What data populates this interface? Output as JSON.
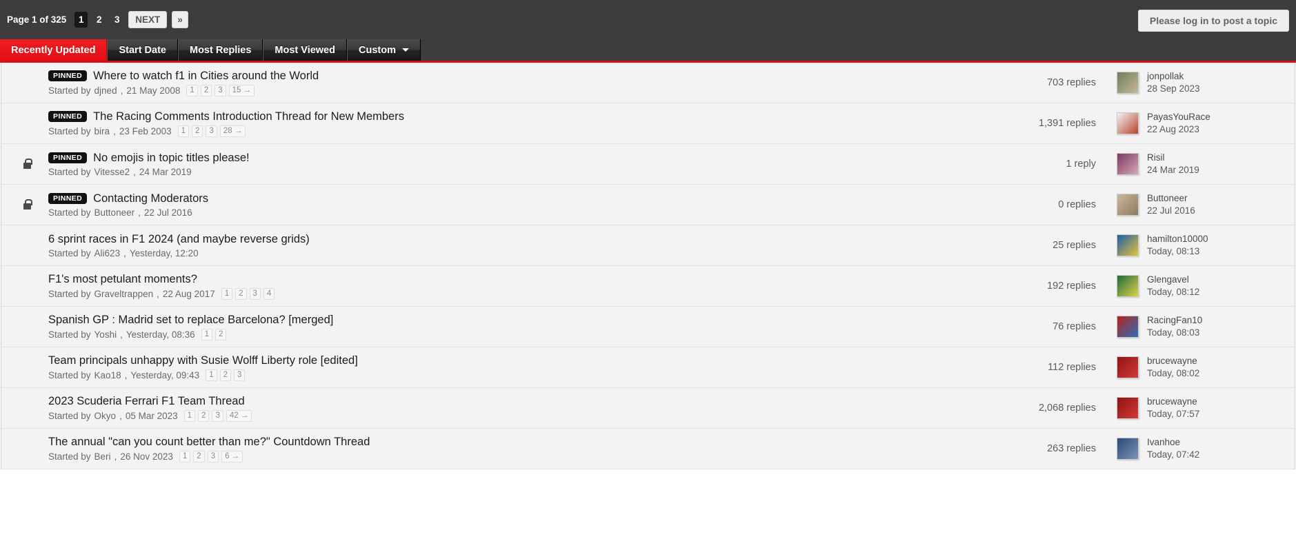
{
  "header": {
    "page_label": "Page 1 of 325",
    "pages": [
      "1",
      "2",
      "3"
    ],
    "next_label": "NEXT",
    "last_label": "»",
    "login_button": "Please log in to post a topic"
  },
  "tabs": [
    {
      "label": "Recently Updated",
      "active": true,
      "caret": false
    },
    {
      "label": "Start Date",
      "active": false,
      "caret": false
    },
    {
      "label": "Most Replies",
      "active": false,
      "caret": false
    },
    {
      "label": "Most Viewed",
      "active": false,
      "caret": false
    },
    {
      "label": "Custom",
      "active": false,
      "caret": true
    }
  ],
  "labels": {
    "started_by": "Started by",
    "comma": ","
  },
  "colors": {
    "accent_red": "#e8131a",
    "topbar": "#3b3b3b",
    "row_bg": "#f3f3f3",
    "pinned_badge": "#111111"
  },
  "topics": [
    {
      "locked": false,
      "pinned": true,
      "pinned_label": "PINNED",
      "title": "Where to watch f1 in Cities around the World",
      "author": "djned",
      "date": "21 May 2008",
      "pages": [
        "1",
        "2",
        "3",
        "15 →"
      ],
      "replies": "703 replies",
      "last_user": "jonpollak",
      "last_date": "28 Sep 2023",
      "avatar_color": "#6d7f5a",
      "avatar_color2": "#c9b79a"
    },
    {
      "locked": false,
      "pinned": true,
      "pinned_label": "PINNED",
      "title": "The Racing Comments Introduction Thread for New Members",
      "author": "bira",
      "date": "23 Feb 2003",
      "pages": [
        "1",
        "2",
        "3",
        "28 →"
      ],
      "replies": "1,391 replies",
      "last_user": "PayasYouRace",
      "last_date": "22 Aug 2023",
      "avatar_color": "#f2f2f2",
      "avatar_color2": "#b8442e"
    },
    {
      "locked": true,
      "pinned": true,
      "pinned_label": "PINNED",
      "title": "No emojis in topic titles please!",
      "author": "Vitesse2",
      "date": "24 Mar 2019",
      "pages": [],
      "replies": "1 reply",
      "last_user": "Risil",
      "last_date": "24 Mar 2019",
      "avatar_color": "#7a3b62",
      "avatar_color2": "#d9a7b8"
    },
    {
      "locked": true,
      "pinned": true,
      "pinned_label": "PINNED",
      "title": "Contacting Moderators",
      "author": "Buttoneer",
      "date": "22 Jul 2016",
      "pages": [],
      "replies": "0 replies",
      "last_user": "Buttoneer",
      "last_date": "22 Jul 2016",
      "avatar_color": "#cbb89c",
      "avatar_color2": "#8b7a5e"
    },
    {
      "locked": false,
      "pinned": false,
      "pinned_label": "",
      "title": "6 sprint races in F1 2024 (and maybe reverse grids)",
      "author": "Ali623",
      "date": "Yesterday, 12:20",
      "pages": [],
      "replies": "25 replies",
      "last_user": "hamilton10000",
      "last_date": "Today, 08:13",
      "avatar_color": "#1b5ea8",
      "avatar_color2": "#e8c33a"
    },
    {
      "locked": false,
      "pinned": false,
      "pinned_label": "",
      "title": "F1's most petulant moments?",
      "author": "Graveltrappen",
      "date": "22 Aug 2017",
      "pages": [
        "1",
        "2",
        "3",
        "4"
      ],
      "replies": "192 replies",
      "last_user": "Glengavel",
      "last_date": "Today, 08:12",
      "avatar_color": "#1d6b3a",
      "avatar_color2": "#e0d24a"
    },
    {
      "locked": false,
      "pinned": false,
      "pinned_label": "",
      "title": "Spanish GP : Madrid set to replace Barcelona? [merged]",
      "author": "Yoshi",
      "date": "Yesterday, 08:36",
      "pages": [
        "1",
        "2"
      ],
      "replies": "76 replies",
      "last_user": "RacingFan10",
      "last_date": "Today, 08:03",
      "avatar_color": "#b32222",
      "avatar_color2": "#2d6fb5"
    },
    {
      "locked": false,
      "pinned": false,
      "pinned_label": "",
      "title": "Team principals unhappy with Susie Wolff Liberty role [edited]",
      "author": "Kao18",
      "date": "Yesterday, 09:43",
      "pages": [
        "1",
        "2",
        "3"
      ],
      "replies": "112 replies",
      "last_user": "brucewayne",
      "last_date": "Today, 08:02",
      "avatar_color": "#8f1212",
      "avatar_color2": "#d33a3a"
    },
    {
      "locked": false,
      "pinned": false,
      "pinned_label": "",
      "title": "2023 Scuderia Ferrari F1 Team Thread",
      "author": "Okyo",
      "date": "05 Mar 2023",
      "pages": [
        "1",
        "2",
        "3",
        "42 →"
      ],
      "replies": "2,068 replies",
      "last_user": "brucewayne",
      "last_date": "Today, 07:57",
      "avatar_color": "#8f1212",
      "avatar_color2": "#d33a3a"
    },
    {
      "locked": false,
      "pinned": false,
      "pinned_label": "",
      "title": "The annual \"can you count better than me?\" Countdown Thread",
      "author": "Beri",
      "date": "26 Nov 2023",
      "pages": [
        "1",
        "2",
        "3",
        "6 →"
      ],
      "replies": "263 replies",
      "last_user": "Ivanhoe",
      "last_date": "Today, 07:42",
      "avatar_color": "#2a4a78",
      "avatar_color2": "#7e93b5"
    }
  ]
}
